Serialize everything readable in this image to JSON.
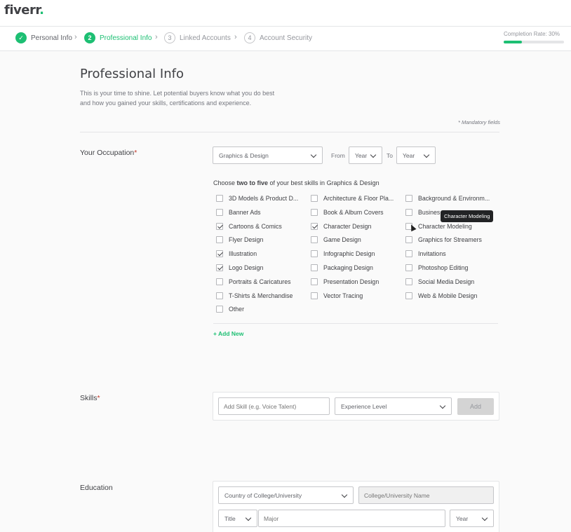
{
  "brand": {
    "name": "fiverr",
    "dot": "."
  },
  "steps": [
    {
      "num": "✓",
      "label": "Personal Info"
    },
    {
      "num": "2",
      "label": "Professional Info"
    },
    {
      "num": "3",
      "label": "Linked Accounts"
    },
    {
      "num": "4",
      "label": "Account Security"
    }
  ],
  "completion": {
    "label": "Completion Rate: 30%",
    "fraction": 0.3
  },
  "page": {
    "title": "Professional Info",
    "intro": "This is your time to shine. Let potential buyers know what you do best and how you gained your skills, certifications and experience.",
    "mandatory": "* Mandatory fields"
  },
  "occupation": {
    "label": "Your Occupation",
    "required": "*",
    "category": "Graphics & Design",
    "from_label": "From",
    "from_value": "Year",
    "to_label": "To",
    "to_value": "Year",
    "prompt_pre": "Choose ",
    "prompt_bold": "two to five",
    "prompt_post": " of your best skills in Graphics & Design",
    "columns": [
      [
        {
          "label": "3D Models & Product D...",
          "checked": false
        },
        {
          "label": "Banner Ads",
          "checked": false
        },
        {
          "label": "Cartoons & Comics",
          "checked": true
        },
        {
          "label": "Flyer Design",
          "checked": false
        },
        {
          "label": "Illustration",
          "checked": true
        },
        {
          "label": "Logo Design",
          "checked": true
        },
        {
          "label": "Portraits & Caricatures",
          "checked": false
        },
        {
          "label": "T-Shirts & Merchandise",
          "checked": false
        },
        {
          "label": "Other",
          "checked": false
        }
      ],
      [
        {
          "label": "Architecture & Floor Pla...",
          "checked": false
        },
        {
          "label": "Book & Album Covers",
          "checked": false
        },
        {
          "label": "Character Design",
          "checked": true
        },
        {
          "label": "Game Design",
          "checked": false
        },
        {
          "label": "Infographic Design",
          "checked": false
        },
        {
          "label": "Packaging Design",
          "checked": false
        },
        {
          "label": "Presentation Design",
          "checked": false
        },
        {
          "label": "Vector Tracing",
          "checked": false
        }
      ],
      [
        {
          "label": "Background & Environm...",
          "checked": false
        },
        {
          "label": "Busines",
          "checked": false
        },
        {
          "label": "Character Modeling",
          "checked": false
        },
        {
          "label": "Graphics for Streamers",
          "checked": false
        },
        {
          "label": "Invitations",
          "checked": false
        },
        {
          "label": "Photoshop Editing",
          "checked": false
        },
        {
          "label": "Social Media Design",
          "checked": false
        },
        {
          "label": "Web & Mobile Design",
          "checked": false
        }
      ]
    ],
    "tooltip": "Character Modeling",
    "add_new": "+ Add New"
  },
  "skills": {
    "label": "Skills",
    "required": "*",
    "skill_placeholder": "Add Skill (e.g. Voice Talent)",
    "level": "Experience Level",
    "add_label": "Add"
  },
  "education": {
    "label": "Education",
    "country": "Country of College/University",
    "college_placeholder": "College/University Name",
    "title": "Title",
    "major_placeholder": "Major",
    "year": "Year"
  }
}
